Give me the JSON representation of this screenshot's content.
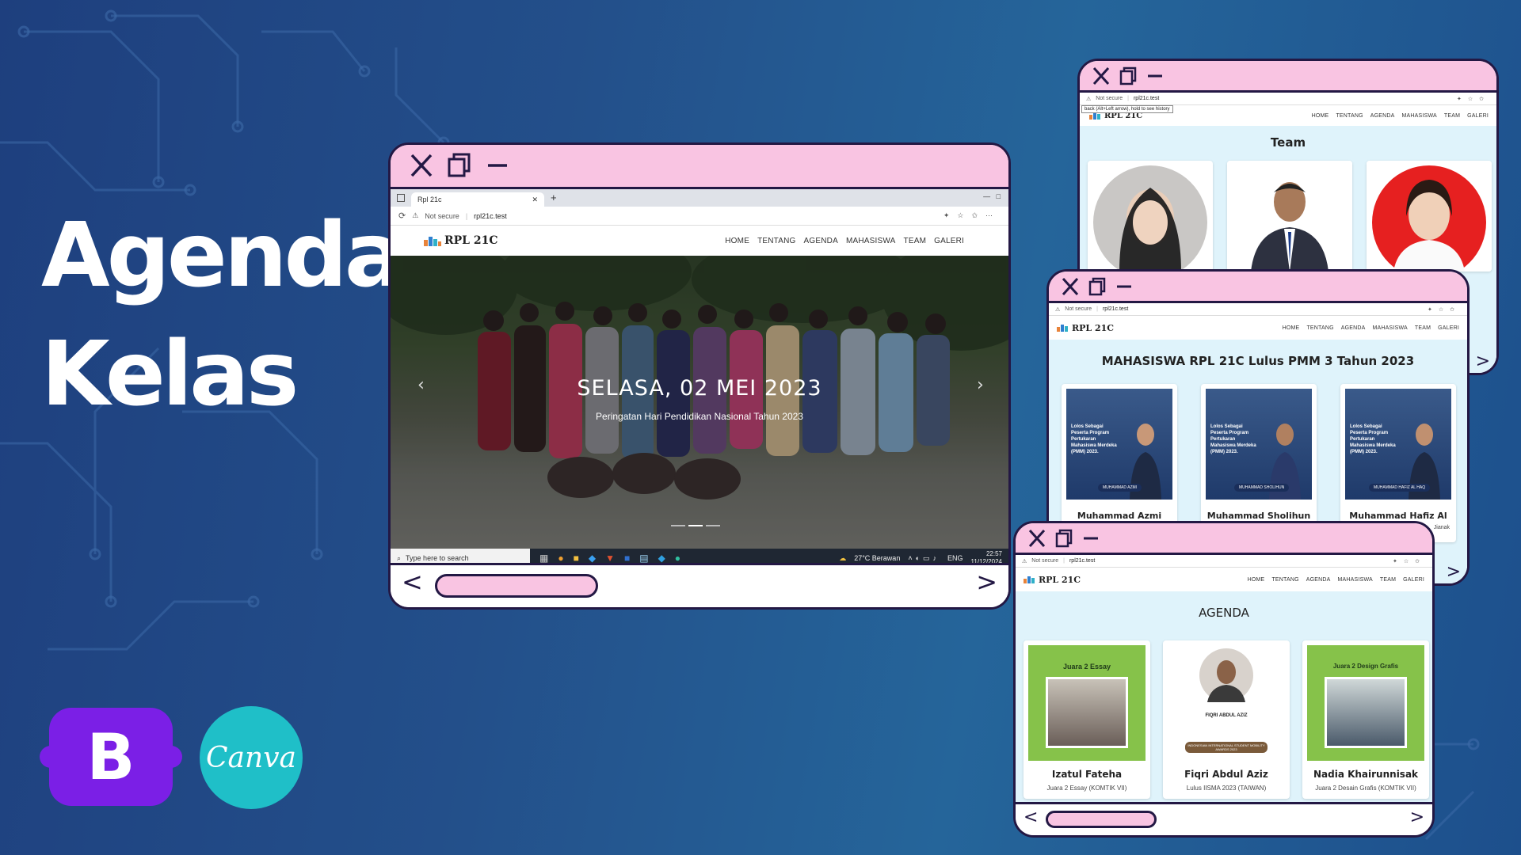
{
  "headline": {
    "line1": "Agenda",
    "line2": "Kelas"
  },
  "logos": {
    "bootstrap_letter": "B",
    "canva_text": "Canva"
  },
  "colors": {
    "bg": "#1f4a8a",
    "frame": "#231844",
    "frame_bar": "#f9c4e2",
    "section_bg": "#dff3fb"
  },
  "browser": {
    "tab_title": "Rpl 21c",
    "not_secure": "Not secure",
    "url": "rpl21c.test",
    "back_tooltip": "back (Alt+Left arrow), hold to see history"
  },
  "site": {
    "brand": "RPL 21C",
    "menu": [
      "HOME",
      "TENTANG",
      "AGENDA",
      "MAHASISWA",
      "TEAM",
      "GALERI"
    ]
  },
  "hero": {
    "title": "SELASA, 02 MEI 2023",
    "subtitle": "Peringatan Hari Pendidikan Nasional Tahun 2023"
  },
  "taskbar": {
    "search_placeholder": "Type here to search",
    "weather": "27°C  Berawan",
    "lang": "ENG",
    "time": "22:57",
    "date": "11/12/2024"
  },
  "team": {
    "heading": "Team"
  },
  "mahasiswa": {
    "heading": "MAHASISWA RPL 21C Lulus PMM 3 Tahun 2023",
    "poster_text": "Lolos Sebagai Peserta Program Pertukaran Mahasiswa Merdeka (PMM) 2023.",
    "cards": [
      {
        "name": "Muhammad Azmi",
        "badge": "MUHAMMAD AZMI"
      },
      {
        "name": "Muhammad Sholihun",
        "badge": "MUHAMMAD SHOLIHUN"
      },
      {
        "name": "Muhammad Hafiz Al Haq",
        "badge": "MUHAMMAD HAFIZ AL HAQ"
      }
    ],
    "peek": "Jianak"
  },
  "agenda": {
    "heading": "AGENDA",
    "cards": [
      {
        "name": "Izatul Fateha",
        "sub": "Juara 2 Essay (KOMTIK VII)",
        "poster_title": "Juara 2 Essay"
      },
      {
        "name": "Fiqri Abdul Aziz",
        "sub": "Lulus IISMA 2023 (TAIWAN)",
        "poster_title": "FIQRI ABDUL AZIZ",
        "award": "INDONESIAN INTERNATIONAL STUDENT MOBILITY AWARDS 2023"
      },
      {
        "name": "Nadia Khairunnisak",
        "sub": "Juara 2 Desain Grafis (KOMTIK VII)",
        "poster_title": "Juara 2 Design Grafis"
      }
    ]
  },
  "icons": {
    "close": "close-icon",
    "maximize": "maximize-icon",
    "minimize": "minimize-icon",
    "prev": "chevron-left-icon",
    "next": "chevron-right-icon"
  },
  "glyphs": {
    "prev": "<",
    "next": ">"
  }
}
